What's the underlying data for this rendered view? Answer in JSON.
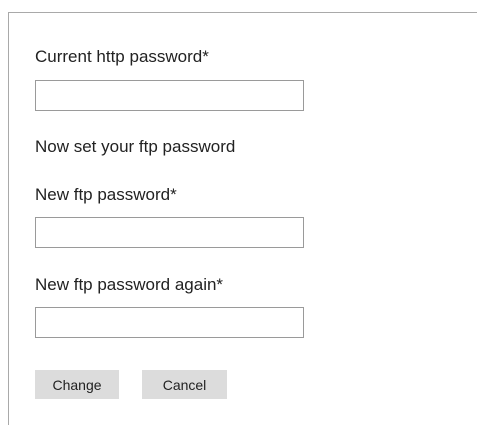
{
  "form": {
    "current_http_password": {
      "label": "Current http password*",
      "value": "",
      "placeholder": ""
    },
    "ftp_intro": "Now set your ftp password",
    "new_ftp_password": {
      "label": "New ftp password*",
      "value": "",
      "placeholder": ""
    },
    "new_ftp_password_again": {
      "label": "New ftp password again*",
      "value": "",
      "placeholder": ""
    },
    "change_label": "Change",
    "cancel_label": "Cancel"
  }
}
